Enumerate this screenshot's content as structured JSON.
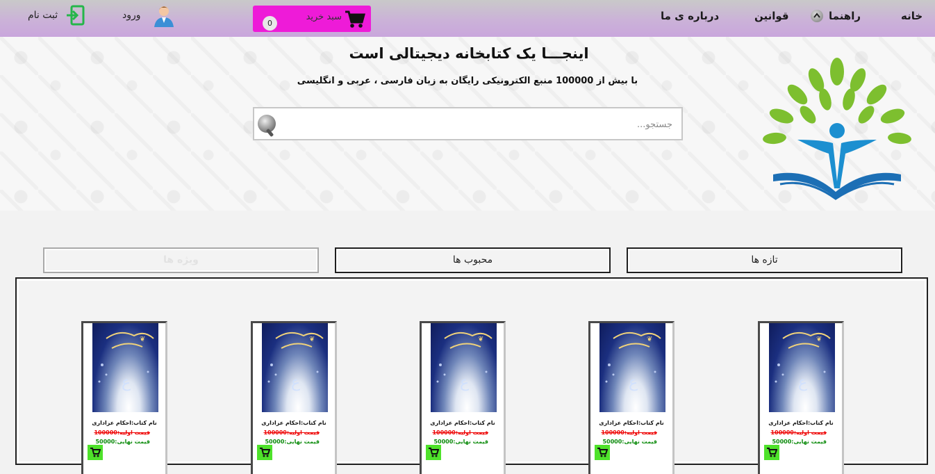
{
  "nav": {
    "home": "خانه",
    "guide": "راهنما",
    "rules": "قوانین",
    "about": "درباره ی ما",
    "cart_label": "سبد خرید",
    "cart_count": "0",
    "login": "ورود",
    "register": "ثبت نام"
  },
  "hero": {
    "title": "اینجـــا یک کتابخانه دیجیتالی است",
    "subtitle": "با بیش از 100000 منبع الکترونیکی رایگان به زبان فارسی ، عربی و انگلیسی",
    "search_placeholder": "جستجو..."
  },
  "tabs": [
    {
      "label": "تازه ها"
    },
    {
      "label": "محبوب ها"
    },
    {
      "label": "ویژه ها"
    }
  ],
  "products": [
    {
      "name": "نام کتاب:احکام عزاداری",
      "old_price": "قیمت اولیه:100000",
      "new_price": "قیمت نهایی:50000"
    },
    {
      "name": "نام کتاب:احکام عزاداری",
      "old_price": "قیمت اولیه:100000",
      "new_price": "قیمت نهایی:50000"
    },
    {
      "name": "نام کتاب:احکام عزاداری",
      "old_price": "قیمت اولیه:100000",
      "new_price": "قیمت نهایی:50000"
    },
    {
      "name": "نام کتاب:احکام عزاداری",
      "old_price": "قیمت اولیه:100000",
      "new_price": "قیمت نهایی:50000"
    },
    {
      "name": "نام کتاب:احکام عزاداری",
      "old_price": "قیمت اولیه:100000",
      "new_price": "قیمت نهایی:50000"
    }
  ],
  "icons": {
    "cart": "cart-icon",
    "user": "user-icon",
    "enter": "enter-icon",
    "search": "search-icon",
    "guide": "chevron-up-icon",
    "logo": "tree-book-logo"
  },
  "colors": {
    "nav_bg": "#cbb2d8",
    "cart_bg": "#ee1bd8",
    "old_price": "#ee0000",
    "new_price": "#0a8a0a",
    "add_cart": "#4ee22a"
  }
}
